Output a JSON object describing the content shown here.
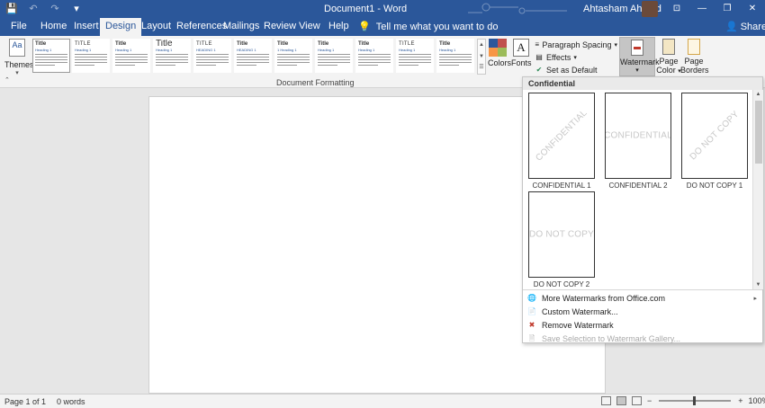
{
  "titlebar": {
    "title": "Document1 - Word",
    "user_name": "Ahtasham Ahmad",
    "qat": {
      "save": "💾",
      "undo": "↶",
      "redo": "↷",
      "customize": "▾"
    },
    "window_buttons": {
      "ribbon_display": "⊡",
      "minimize": "—",
      "restore": "❐",
      "close": "✕"
    }
  },
  "tabs": [
    "File",
    "Home",
    "Insert",
    "Design",
    "Layout",
    "References",
    "Mailings",
    "Review",
    "View",
    "Help"
  ],
  "active_tab": "Design",
  "tell_me": "Tell me what you want to do",
  "share": "Share",
  "ribbon": {
    "themes_label": "Themes",
    "themes_icon_text": "Aa",
    "style_gallery": [
      {
        "title": "Title",
        "heading": "Heading 1",
        "style": "bold"
      },
      {
        "title": "TITLE",
        "heading": "Heading 1",
        "style": "caps"
      },
      {
        "title": "Title",
        "heading": "Heading 1",
        "style": "bold"
      },
      {
        "title": "Title",
        "heading": "Heading 1",
        "style": "big"
      },
      {
        "title": "TITLE",
        "heading": "HEADING 1",
        "style": "caps"
      },
      {
        "title": "Title",
        "heading": "HEADING 1",
        "style": "bold"
      },
      {
        "title": "Title",
        "heading": "1 Heading 1",
        "style": "bold"
      },
      {
        "title": "Title",
        "heading": "Heading 1",
        "style": "bold"
      },
      {
        "title": "Title",
        "heading": "Heading 1",
        "style": "bold"
      },
      {
        "title": "TITLE",
        "heading": "Heading 1",
        "style": "caps"
      },
      {
        "title": "Title",
        "heading": "Heading 1",
        "style": "bold"
      }
    ],
    "colors_label": "Colors",
    "fonts_label": "Fonts",
    "fonts_icon_text": "A",
    "paragraph_spacing": "Paragraph Spacing",
    "effects": "Effects",
    "set_as_default": "Set as Default",
    "watermark_label": "Watermark",
    "page_color_label_1": "Page",
    "page_color_label_2": "Color",
    "page_borders_label_1": "Page",
    "page_borders_label_2": "Borders",
    "group_label": "Document Formatting",
    "theme_colors": [
      "#2b579a",
      "#c0504d",
      "#f79646",
      "#9bbb59"
    ]
  },
  "watermark_dropdown": {
    "header": "Confidential",
    "items": [
      {
        "text": "CONFIDENTIAL",
        "caption": "CONFIDENTIAL 1",
        "orientation": "diagonal"
      },
      {
        "text": "CONFIDENTIAL",
        "caption": "CONFIDENTIAL 2",
        "orientation": "horizontal"
      },
      {
        "text": "DO NOT COPY",
        "caption": "DO NOT COPY 1",
        "orientation": "diagonal"
      },
      {
        "text": "DO NOT COPY",
        "caption": "DO NOT COPY 2",
        "orientation": "horizontal"
      }
    ],
    "menu": [
      {
        "label": "More Watermarks from Office.com",
        "icon": "web-icon",
        "disabled": false,
        "submenu": true
      },
      {
        "label": "Custom Watermark...",
        "icon": "page-icon",
        "disabled": false,
        "submenu": false
      },
      {
        "label": "Remove Watermark",
        "icon": "remove-icon",
        "disabled": false,
        "submenu": false
      },
      {
        "label": "Save Selection to Watermark Gallery...",
        "icon": "save-gallery-icon",
        "disabled": true,
        "submenu": false
      }
    ]
  },
  "statusbar": {
    "page": "Page 1 of 1",
    "words": "0 words",
    "zoom_minus": "−",
    "zoom_plus": "+",
    "zoom": "100%"
  }
}
